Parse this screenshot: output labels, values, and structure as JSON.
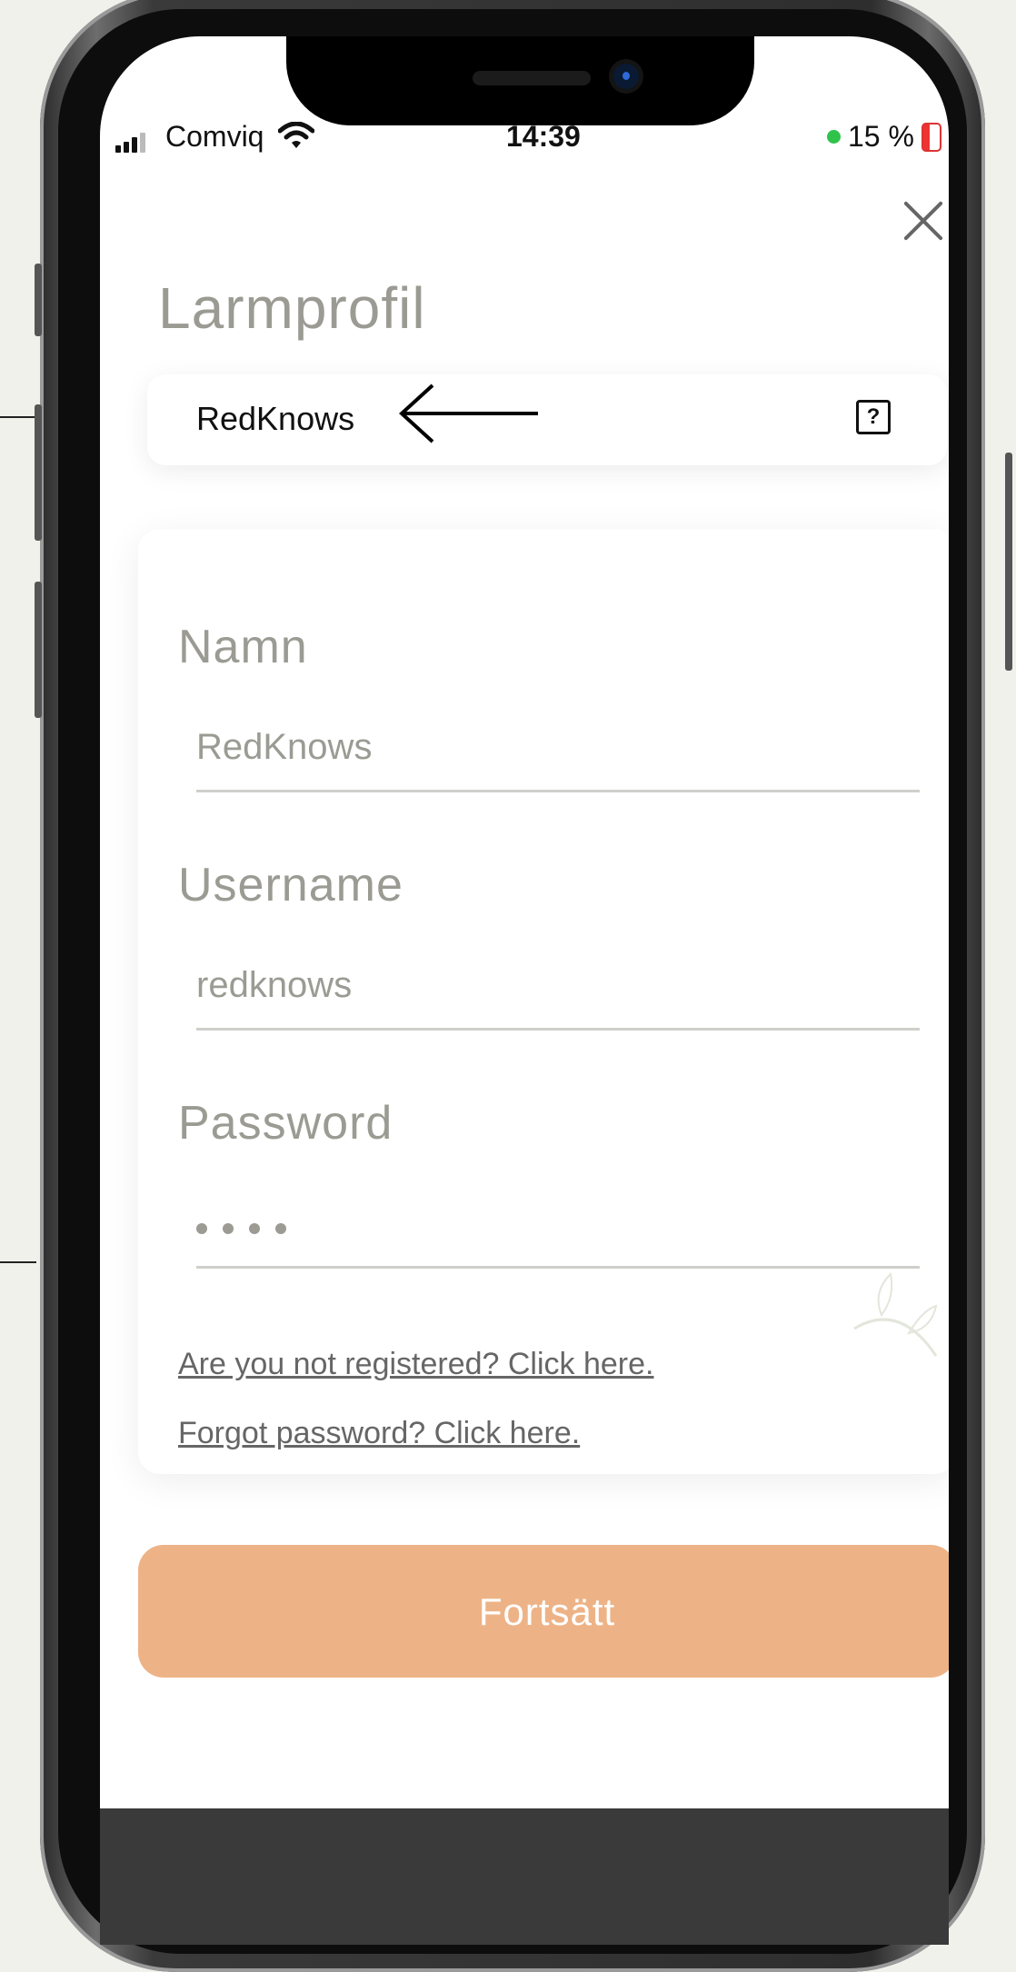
{
  "statusbar": {
    "carrier": "Comviq",
    "time": "14:39",
    "battery": "15 %"
  },
  "page": {
    "title": "Larmprofil"
  },
  "profile": {
    "name": "RedKnows",
    "help_label": "?"
  },
  "form": {
    "name_label": "Namn",
    "name_value": "RedKnows",
    "username_label": "Username",
    "username_value": "redknows",
    "password_label": "Password",
    "password_length": 4,
    "register_link": "Are you not registered? Click here.",
    "forgot_link": "Forgot password? Click here."
  },
  "actions": {
    "continue_label": "Fortsätt"
  },
  "colors": {
    "accent": "#edb387",
    "label": "#9b9b94",
    "battery_dot": "#2fc34b"
  },
  "icons": [
    "wifi-icon",
    "signal-icon",
    "battery-icon",
    "close-icon",
    "back-arrow-icon",
    "help-icon",
    "leaf-icon"
  ]
}
